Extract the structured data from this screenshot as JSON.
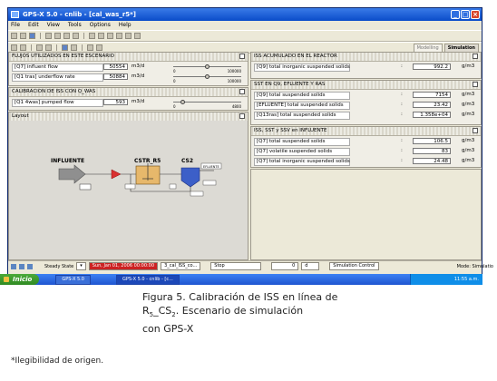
{
  "window": {
    "title": "GPS-X 5.0 - cnlib - [cal_was_r5*]",
    "menu": [
      "File",
      "Edit",
      "View",
      "Tools",
      "Options",
      "Help"
    ]
  },
  "mode_tabs": [
    "Modelling",
    "Simulation"
  ],
  "panels": {
    "flows": {
      "header": "FLUJOS UTILIZADOS EN ESTE ESCENARIO",
      "rows": [
        {
          "label": "[Q7] influent flow",
          "value": "50554",
          "unit": "m3/d",
          "slider_min": "0",
          "slider_max": "100000",
          "level": 0.5
        },
        {
          "label": "[Q1 tras] underflow rate",
          "value": "50884",
          "unit": "m3/d",
          "slider_min": "0",
          "slider_max": "100000",
          "level": 0.5
        }
      ]
    },
    "calibration": {
      "header": "CALIBRACION DE ISS CON Q_WAS",
      "rows": [
        {
          "label": "[Q1 4was] pumped flow",
          "value": "593",
          "unit": "m3/d",
          "slider_min": "0",
          "slider_max": "4800",
          "level": 0.12
        }
      ]
    },
    "layout": {
      "header": "Layout",
      "labels": {
        "influent": "INFLUENTE",
        "cstr": "CSTR_R5",
        "cs2": "CS2",
        "effluent": "EFLUENTE"
      }
    },
    "iss_reactor": {
      "header": "ISS ACUMULADO EN EL REACTOR",
      "rows": [
        {
          "label": "[Q9] total inorganic suspended solids",
          "value": "992.2",
          "unit": "g/m3"
        }
      ]
    },
    "sst_q9": {
      "header": "SST EN Q9, EFLUENTE Y RAS",
      "rows": [
        {
          "label": "[Q9] total suspended solids",
          "value": "7154",
          "unit": "g/m3"
        },
        {
          "label": "[EFLUENTE] total suspended solids",
          "value": "23.42",
          "unit": "g/m3"
        },
        {
          "label": "[Q13ras] total suspended solids",
          "value": "1.358e+04",
          "unit": "g/m3"
        }
      ]
    },
    "iss_influent": {
      "header": "ISS, SST y SSV en INFLUENTE",
      "rows": [
        {
          "label": "[Q7] total suspended solids",
          "value": "106.5",
          "unit": "g/m3"
        },
        {
          "label": "[Q7] volatile suspended solids",
          "value": "83",
          "unit": "g/m3"
        },
        {
          "label": "[Q7] total inorganic suspended solids",
          "value": "24.48",
          "unit": "g/m3"
        }
      ]
    }
  },
  "statusbar": {
    "steady_state": "Steady State",
    "date": "Sun, Jan 01, 2006 00:00:00",
    "scenario": "3_cal_ISS_co...",
    "stop": "Stop",
    "value": "0",
    "unit": "d",
    "sim_control": "Simulation Control"
  },
  "mode_text": "Mode: Simulatio",
  "taskbar": {
    "start": "Inicio",
    "tasks": [
      "GPS-X 5.0",
      "GPS-X 5.0 - cnlib - [c..."
    ],
    "clock": "11:55 a.m."
  },
  "caption": {
    "line1": "Figura 5. Calibración de ISS en línea de",
    "line2_pre": "R",
    "line2_sub1": "5",
    "line2_mid": "_CS",
    "line2_sub2": "2",
    "line2_post": ". Escenario de simulación",
    "line3": "con GPS-X"
  },
  "footnote": "*Ilegibilidad de origen."
}
